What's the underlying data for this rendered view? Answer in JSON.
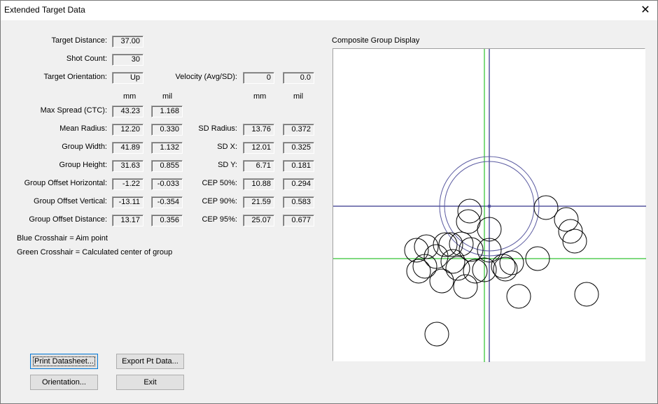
{
  "window": {
    "title": "Extended Target Data",
    "close_glyph": "✕"
  },
  "fields": {
    "target_distance": {
      "label": "Target Distance:",
      "value": "37.00"
    },
    "shot_count": {
      "label": "Shot Count:",
      "value": "30"
    },
    "target_orientation": {
      "label": "Target Orientation:",
      "value": "Up"
    },
    "velocity": {
      "label": "Velocity (Avg/SD):",
      "avg": "0",
      "sd": "0.0"
    }
  },
  "columns": {
    "mm": "mm",
    "mil": "mil",
    "mm2": "mm",
    "mil2": "mil"
  },
  "left_rows": [
    {
      "label": "Max Spread (CTC):",
      "mm": "43.23",
      "mil": "1.168"
    },
    {
      "label": "Mean Radius:",
      "mm": "12.20",
      "mil": "0.330"
    },
    {
      "label": "Group Width:",
      "mm": "41.89",
      "mil": "1.132"
    },
    {
      "label": "Group Height:",
      "mm": "31.63",
      "mil": "0.855"
    },
    {
      "label": "Group Offset Horizontal:",
      "mm": "-1.22",
      "mil": "-0.033"
    },
    {
      "label": "Group Offset Vertical:",
      "mm": "-13.11",
      "mil": "-0.354"
    },
    {
      "label": "Group Offset Distance:",
      "mm": "13.17",
      "mil": "0.356"
    }
  ],
  "right_rows": [
    {
      "label": "SD Radius:",
      "mm": "13.76",
      "mil": "0.372"
    },
    {
      "label": "SD X:",
      "mm": "12.01",
      "mil": "0.325"
    },
    {
      "label": "SD Y:",
      "mm": "6.71",
      "mil": "0.181"
    },
    {
      "label": "CEP 50%:",
      "mm": "10.88",
      "mil": "0.294"
    },
    {
      "label": "CEP 90%:",
      "mm": "21.59",
      "mil": "0.583"
    },
    {
      "label": "CEP 95%:",
      "mm": "25.07",
      "mil": "0.677"
    }
  ],
  "legend": {
    "blue": "Blue Crosshair = Aim point",
    "green": "Green Crosshair = Calculated center of group"
  },
  "buttons": {
    "print": "Print Datasheet...",
    "export": "Export Pt Data...",
    "orientation": "Orientation...",
    "exit": "Exit"
  },
  "display": {
    "title": "Composite Group Display",
    "colors": {
      "aim_crosshair": "#00006e",
      "center_crosshair": "#00b400",
      "mean_radius_ring": "#5a5aa0",
      "shots": "#000000"
    }
  }
}
